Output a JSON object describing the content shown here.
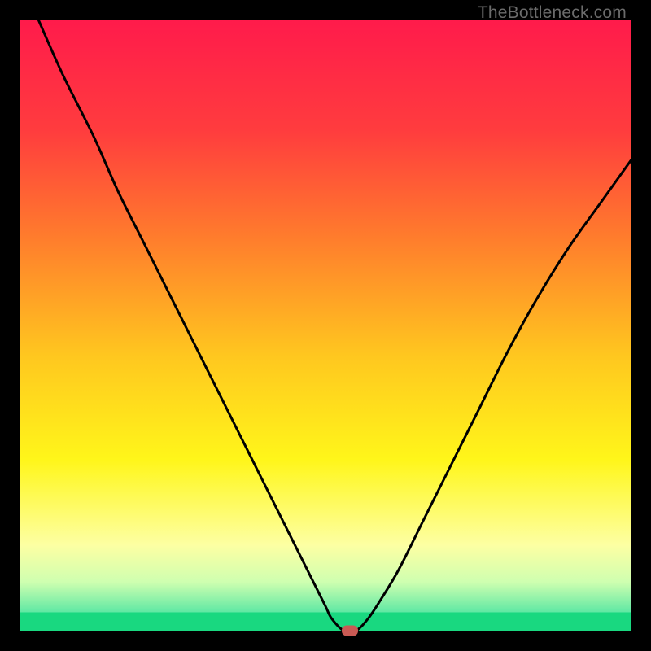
{
  "watermark": "TheBottleneck.com",
  "chart_data": {
    "type": "line",
    "title": "",
    "xlabel": "",
    "ylabel": "",
    "xlim": [
      0,
      100
    ],
    "ylim": [
      0,
      100
    ],
    "grid": false,
    "series": [
      {
        "name": "curve",
        "x": [
          3,
          7,
          12,
          16,
          20,
          24,
          28,
          32,
          36,
          40,
          43,
          46,
          48,
          50,
          51,
          53,
          55,
          57,
          59,
          62,
          66,
          70,
          75,
          80,
          85,
          90,
          95,
          100
        ],
        "y": [
          100,
          91,
          81,
          72,
          64,
          56,
          48,
          40,
          32,
          24,
          18,
          12,
          8,
          4,
          2,
          0,
          0,
          2,
          5,
          10,
          18,
          26,
          36,
          46,
          55,
          63,
          70,
          77
        ]
      }
    ],
    "marker": {
      "x": 54,
      "y": 0,
      "shape": "rounded-rect",
      "color": "#c95a54"
    },
    "background_gradient": {
      "stops": [
        {
          "offset": 0.0,
          "color": "#ff1b4b"
        },
        {
          "offset": 0.18,
          "color": "#ff3c3e"
        },
        {
          "offset": 0.35,
          "color": "#ff7a2d"
        },
        {
          "offset": 0.55,
          "color": "#ffc71f"
        },
        {
          "offset": 0.72,
          "color": "#fff61a"
        },
        {
          "offset": 0.86,
          "color": "#fdffa3"
        },
        {
          "offset": 0.92,
          "color": "#cfffb0"
        },
        {
          "offset": 0.97,
          "color": "#5fe8a4"
        },
        {
          "offset": 1.0,
          "color": "#19d880"
        }
      ]
    },
    "green_band": {
      "y0": 0,
      "y1": 3
    }
  }
}
